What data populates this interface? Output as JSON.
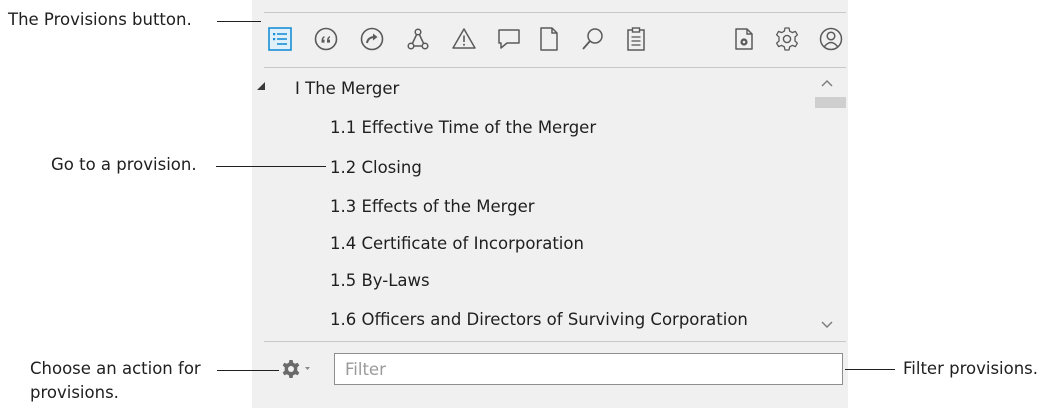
{
  "toolbar": {
    "buttons": [
      {
        "name": "provisions-icon",
        "active": true
      },
      {
        "name": "quotes-icon"
      },
      {
        "name": "go-arrow-icon"
      },
      {
        "name": "network-icon"
      },
      {
        "name": "warning-icon"
      },
      {
        "name": "comment-icon"
      },
      {
        "name": "document-icon"
      },
      {
        "name": "search-icon"
      },
      {
        "name": "clipboard-icon"
      },
      {
        "name": "doc-settings-icon"
      },
      {
        "name": "settings-icon"
      },
      {
        "name": "account-icon"
      }
    ],
    "accent_color": "#1a8fd6"
  },
  "tree": {
    "section": "I The Merger",
    "items": [
      "1.1 Effective Time of the Merger",
      "1.2 Closing",
      "1.3 Effects of the Merger",
      "1.4 Certificate of Incorporation",
      "1.5 By-Laws",
      "1.6 Officers and Directors of Surviving Corporation"
    ]
  },
  "filter": {
    "placeholder": "Filter"
  },
  "callouts": {
    "provisions_button": "The Provisions button.",
    "go_to_provision": "Go to a provision.",
    "choose_action_line1": "Choose an action for",
    "choose_action_line2": "provisions.",
    "filter_provisions": "Filter provisions."
  }
}
